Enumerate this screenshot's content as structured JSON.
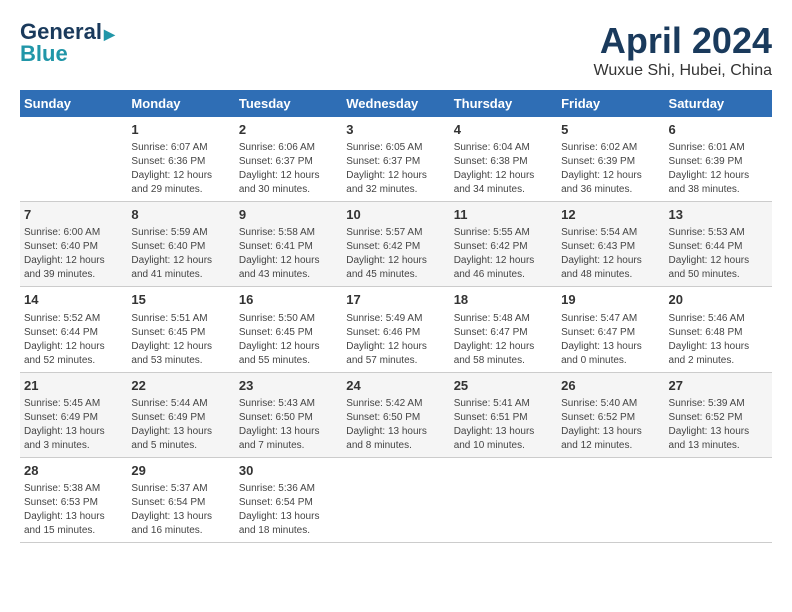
{
  "header": {
    "logo_line1": "General",
    "logo_line2": "Blue",
    "month": "April 2024",
    "location": "Wuxue Shi, Hubei, China"
  },
  "days_of_week": [
    "Sunday",
    "Monday",
    "Tuesday",
    "Wednesday",
    "Thursday",
    "Friday",
    "Saturday"
  ],
  "weeks": [
    [
      {
        "day": "",
        "info": ""
      },
      {
        "day": "1",
        "info": "Sunrise: 6:07 AM\nSunset: 6:36 PM\nDaylight: 12 hours\nand 29 minutes."
      },
      {
        "day": "2",
        "info": "Sunrise: 6:06 AM\nSunset: 6:37 PM\nDaylight: 12 hours\nand 30 minutes."
      },
      {
        "day": "3",
        "info": "Sunrise: 6:05 AM\nSunset: 6:37 PM\nDaylight: 12 hours\nand 32 minutes."
      },
      {
        "day": "4",
        "info": "Sunrise: 6:04 AM\nSunset: 6:38 PM\nDaylight: 12 hours\nand 34 minutes."
      },
      {
        "day": "5",
        "info": "Sunrise: 6:02 AM\nSunset: 6:39 PM\nDaylight: 12 hours\nand 36 minutes."
      },
      {
        "day": "6",
        "info": "Sunrise: 6:01 AM\nSunset: 6:39 PM\nDaylight: 12 hours\nand 38 minutes."
      }
    ],
    [
      {
        "day": "7",
        "info": "Sunrise: 6:00 AM\nSunset: 6:40 PM\nDaylight: 12 hours\nand 39 minutes."
      },
      {
        "day": "8",
        "info": "Sunrise: 5:59 AM\nSunset: 6:40 PM\nDaylight: 12 hours\nand 41 minutes."
      },
      {
        "day": "9",
        "info": "Sunrise: 5:58 AM\nSunset: 6:41 PM\nDaylight: 12 hours\nand 43 minutes."
      },
      {
        "day": "10",
        "info": "Sunrise: 5:57 AM\nSunset: 6:42 PM\nDaylight: 12 hours\nand 45 minutes."
      },
      {
        "day": "11",
        "info": "Sunrise: 5:55 AM\nSunset: 6:42 PM\nDaylight: 12 hours\nand 46 minutes."
      },
      {
        "day": "12",
        "info": "Sunrise: 5:54 AM\nSunset: 6:43 PM\nDaylight: 12 hours\nand 48 minutes."
      },
      {
        "day": "13",
        "info": "Sunrise: 5:53 AM\nSunset: 6:44 PM\nDaylight: 12 hours\nand 50 minutes."
      }
    ],
    [
      {
        "day": "14",
        "info": "Sunrise: 5:52 AM\nSunset: 6:44 PM\nDaylight: 12 hours\nand 52 minutes."
      },
      {
        "day": "15",
        "info": "Sunrise: 5:51 AM\nSunset: 6:45 PM\nDaylight: 12 hours\nand 53 minutes."
      },
      {
        "day": "16",
        "info": "Sunrise: 5:50 AM\nSunset: 6:45 PM\nDaylight: 12 hours\nand 55 minutes."
      },
      {
        "day": "17",
        "info": "Sunrise: 5:49 AM\nSunset: 6:46 PM\nDaylight: 12 hours\nand 57 minutes."
      },
      {
        "day": "18",
        "info": "Sunrise: 5:48 AM\nSunset: 6:47 PM\nDaylight: 12 hours\nand 58 minutes."
      },
      {
        "day": "19",
        "info": "Sunrise: 5:47 AM\nSunset: 6:47 PM\nDaylight: 13 hours\nand 0 minutes."
      },
      {
        "day": "20",
        "info": "Sunrise: 5:46 AM\nSunset: 6:48 PM\nDaylight: 13 hours\nand 2 minutes."
      }
    ],
    [
      {
        "day": "21",
        "info": "Sunrise: 5:45 AM\nSunset: 6:49 PM\nDaylight: 13 hours\nand 3 minutes."
      },
      {
        "day": "22",
        "info": "Sunrise: 5:44 AM\nSunset: 6:49 PM\nDaylight: 13 hours\nand 5 minutes."
      },
      {
        "day": "23",
        "info": "Sunrise: 5:43 AM\nSunset: 6:50 PM\nDaylight: 13 hours\nand 7 minutes."
      },
      {
        "day": "24",
        "info": "Sunrise: 5:42 AM\nSunset: 6:50 PM\nDaylight: 13 hours\nand 8 minutes."
      },
      {
        "day": "25",
        "info": "Sunrise: 5:41 AM\nSunset: 6:51 PM\nDaylight: 13 hours\nand 10 minutes."
      },
      {
        "day": "26",
        "info": "Sunrise: 5:40 AM\nSunset: 6:52 PM\nDaylight: 13 hours\nand 12 minutes."
      },
      {
        "day": "27",
        "info": "Sunrise: 5:39 AM\nSunset: 6:52 PM\nDaylight: 13 hours\nand 13 minutes."
      }
    ],
    [
      {
        "day": "28",
        "info": "Sunrise: 5:38 AM\nSunset: 6:53 PM\nDaylight: 13 hours\nand 15 minutes."
      },
      {
        "day": "29",
        "info": "Sunrise: 5:37 AM\nSunset: 6:54 PM\nDaylight: 13 hours\nand 16 minutes."
      },
      {
        "day": "30",
        "info": "Sunrise: 5:36 AM\nSunset: 6:54 PM\nDaylight: 13 hours\nand 18 minutes."
      },
      {
        "day": "",
        "info": ""
      },
      {
        "day": "",
        "info": ""
      },
      {
        "day": "",
        "info": ""
      },
      {
        "day": "",
        "info": ""
      }
    ]
  ]
}
